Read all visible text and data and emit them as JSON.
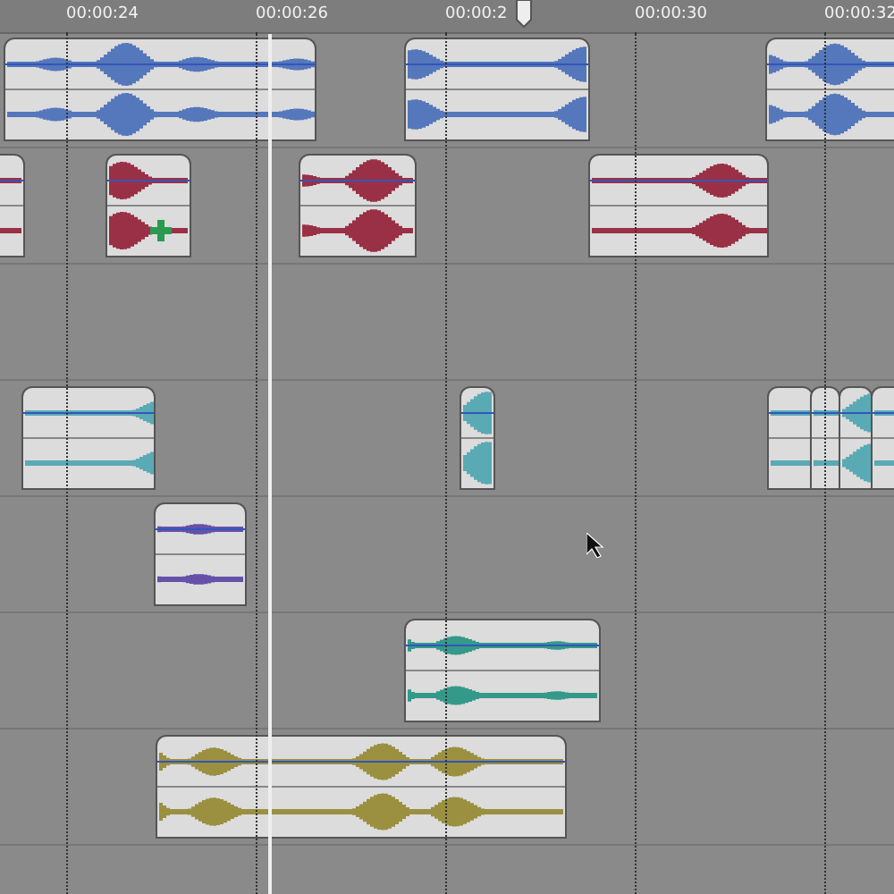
{
  "ruler": {
    "labels": [
      "00:00:24",
      "00:00:26",
      "00:00:2",
      "00:00:30",
      "00:00:32"
    ]
  },
  "tracks": [
    {
      "kind": "audio",
      "clips": [
        {
          "color": "#5577bb"
        },
        {
          "color": "#5577bb"
        },
        {
          "color": "#5577bb"
        }
      ]
    },
    {
      "kind": "audio",
      "clips": [
        {
          "color": "#9a3045"
        },
        {
          "color": "#9a3045"
        },
        {
          "color": "#9a3045"
        },
        {
          "color": "#9a3045"
        }
      ]
    },
    {
      "kind": "empty"
    },
    {
      "kind": "audio",
      "clips": [
        {
          "color": "#5aaab5"
        },
        {
          "color": "#5aaab5"
        },
        {
          "color": "#5aaab5"
        },
        {
          "color": "#5aaab5"
        },
        {
          "color": "#5aaab5"
        },
        {
          "color": "#5aaab5"
        }
      ]
    },
    {
      "kind": "audio",
      "clips": [
        {
          "color": "#6650a8"
        }
      ]
    },
    {
      "kind": "audio",
      "clips": [
        {
          "color": "#35998a"
        }
      ]
    },
    {
      "kind": "audio",
      "clips": [
        {
          "color": "#9a9040"
        }
      ]
    }
  ]
}
